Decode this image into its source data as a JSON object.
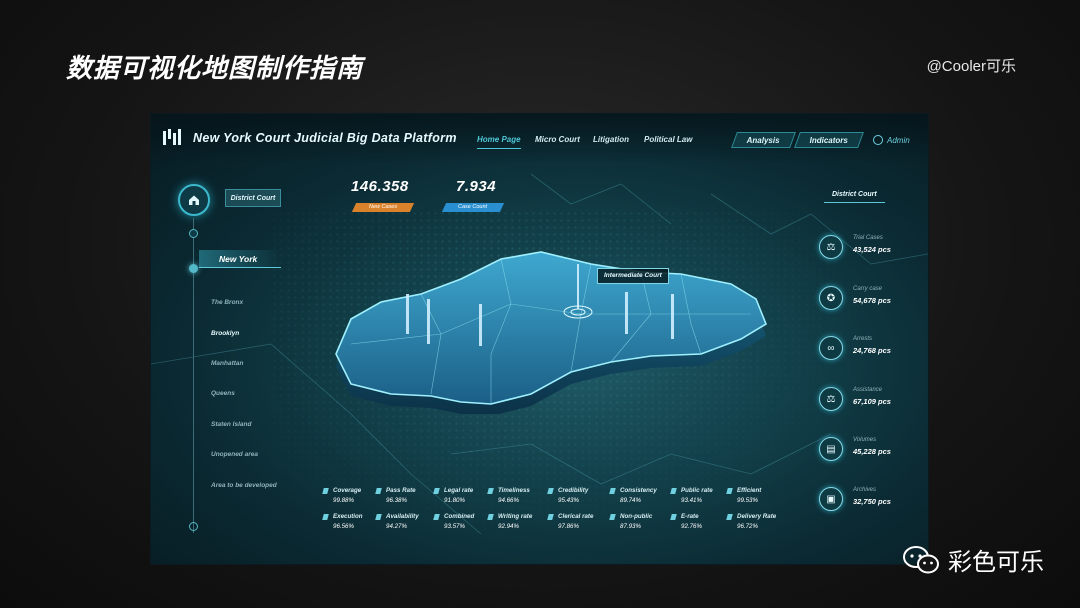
{
  "slide": {
    "title": "数据可视化地图制作指南",
    "author": "@Cooler可乐",
    "watermark": "彩色可乐"
  },
  "dashboard": {
    "title": "New York Court Judicial Big Data Platform",
    "nav": [
      "Home Page",
      "Micro Court",
      "Litigation",
      "Political Law"
    ],
    "active_nav": "Home Page",
    "pills": [
      "Analysis",
      "Indicators"
    ],
    "admin": "Admin",
    "district_tag": "District Court",
    "stats": [
      {
        "value": "146.358",
        "label": "New Cases",
        "color": "#d9822b"
      },
      {
        "value": "7.934",
        "label": "Case Count",
        "color": "#2a8fd0"
      }
    ],
    "selected_region": "New York",
    "regions": [
      "The Bronx",
      "Brooklyn",
      "Manhattan",
      "Queens",
      "Staten Island",
      "Unopened area",
      "Area to be developed"
    ],
    "map_label": "Intermediate Court",
    "right_title": "District Court",
    "metrics": [
      {
        "label": "Trial Cases",
        "value": "43,524 pcs",
        "icon": "gavel-icon"
      },
      {
        "label": "Carry case",
        "value": "54,678 pcs",
        "icon": "badge-icon"
      },
      {
        "label": "Arrests",
        "value": "24,768 pcs",
        "icon": "handcuffs-icon"
      },
      {
        "label": "Assistance",
        "value": "67,109 pcs",
        "icon": "scales-icon"
      },
      {
        "label": "Volumes",
        "value": "45,228 pcs",
        "icon": "books-icon"
      },
      {
        "label": "Archives",
        "value": "32,750 pcs",
        "icon": "archive-icon"
      }
    ],
    "kpis": [
      {
        "label": "Coverage",
        "value": "99.88%"
      },
      {
        "label": "Pass Rate",
        "value": "96.38%"
      },
      {
        "label": "Legal rate",
        "value": "91.80%"
      },
      {
        "label": "Timeliness",
        "value": "94.66%"
      },
      {
        "label": "Credibility",
        "value": "95.43%"
      },
      {
        "label": "Consistency",
        "value": "89.74%"
      },
      {
        "label": "Public rate",
        "value": "93.41%"
      },
      {
        "label": "Efficient",
        "value": "99.53%"
      },
      {
        "label": "Execution",
        "value": "96.56%"
      },
      {
        "label": "Availability",
        "value": "94.27%"
      },
      {
        "label": "Combined",
        "value": "93.57%"
      },
      {
        "label": "Writing rate",
        "value": "92.94%"
      },
      {
        "label": "Clerical rate",
        "value": "97.86%"
      },
      {
        "label": "Non-public",
        "value": "87.93%"
      },
      {
        "label": "E-rate",
        "value": "92.76%"
      },
      {
        "label": "Delivery Rate",
        "value": "96.72%"
      }
    ]
  }
}
